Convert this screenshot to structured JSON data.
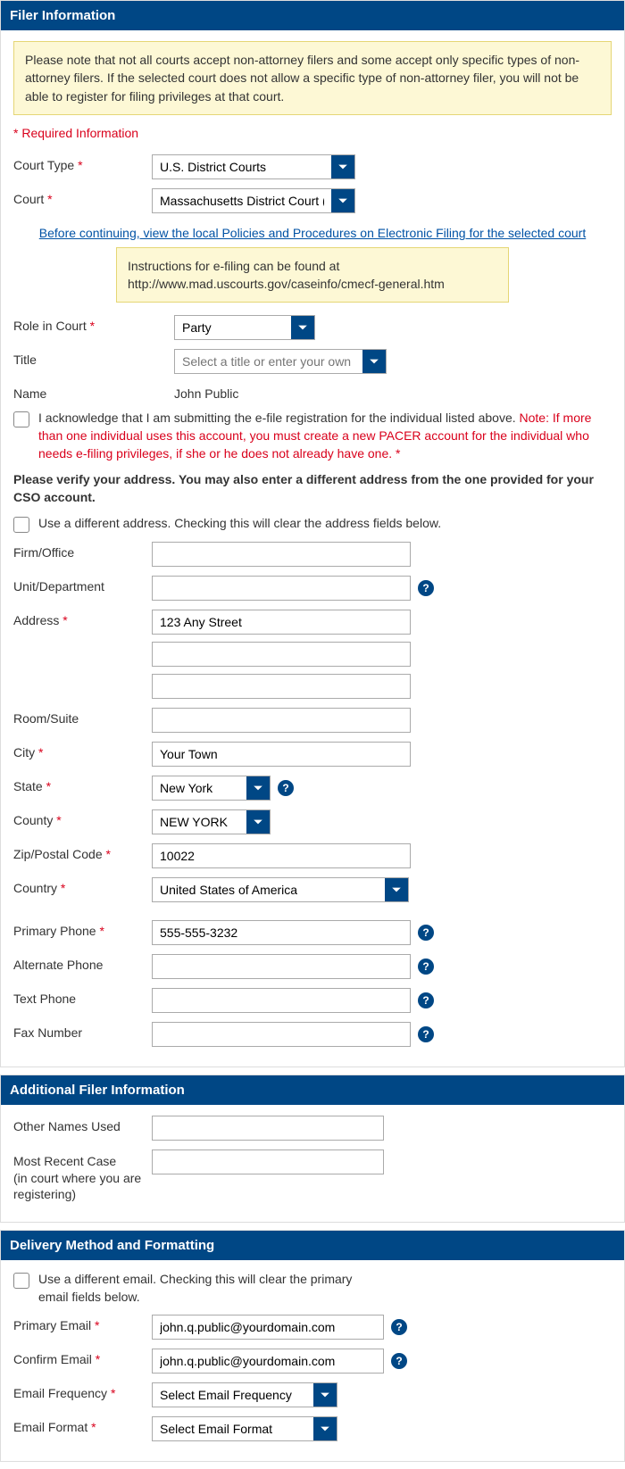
{
  "sections": {
    "filer": "Filer Information",
    "additional": "Additional Filer Information",
    "delivery": "Delivery Method and Formatting"
  },
  "notice": "Please note that not all courts accept non-attorney filers and some accept only specific types of non-attorney filers. If the selected court does not allow a specific type of non-attorney filer, you will not be able to register for filing privileges at that court.",
  "required_info": "* Required Information",
  "labels": {
    "court_type": "Court Type",
    "court": "Court",
    "role": "Role in Court",
    "title": "Title",
    "name": "Name",
    "firm": "Firm/Office",
    "unit": "Unit/Department",
    "address": "Address",
    "room": "Room/Suite",
    "city": "City",
    "state": "State",
    "county": "County",
    "zip": "Zip/Postal Code",
    "country": "Country",
    "primary_phone": "Primary Phone",
    "alt_phone": "Alternate Phone",
    "text_phone": "Text Phone",
    "fax": "Fax Number",
    "other_names": "Other Names Used",
    "recent_case": "Most Recent Case",
    "recent_case_sub": "(in court where you are registering)",
    "primary_email": "Primary Email",
    "confirm_email": "Confirm Email",
    "email_freq": "Email Frequency",
    "email_format": "Email Format"
  },
  "values": {
    "court_type": "U.S. District Courts",
    "court": "Massachusetts District Court (t",
    "role": "Party",
    "name": "John Public",
    "address1": "123 Any Street",
    "city": "Your Town",
    "state": "New York",
    "county": "NEW YORK",
    "zip": "10022",
    "country": "United States of America",
    "primary_phone": "555-555-3232",
    "primary_email": "john.q.public@yourdomain.com",
    "confirm_email": "john.q.public@yourdomain.com",
    "email_freq": "Select Email Frequency",
    "email_format": "Select Email Format"
  },
  "placeholders": {
    "title": "Select a title or enter your own"
  },
  "link_text": "Before continuing, view the local Policies and Procedures on Electronic Filing for the selected court",
  "instructions_box": "Instructions for e-filing can be found at http://www.mad.uscourts.gov/caseinfo/cmecf-general.htm",
  "ack_text_start": "I acknowledge that I am submitting the e-file registration for the individual listed above. ",
  "ack_note": "Note: If more than one individual uses this account, you must create a new PACER account for the individual who needs e-filing privileges, if she or he does not already have one.",
  "ack_req": " *",
  "verify_text": "Please verify your address. You may also enter a different address from the one provided for your CSO account.",
  "diff_address": "Use a different address. Checking this will clear the address fields below.",
  "diff_email": "Use a different email. Checking this will clear the primary email fields below."
}
